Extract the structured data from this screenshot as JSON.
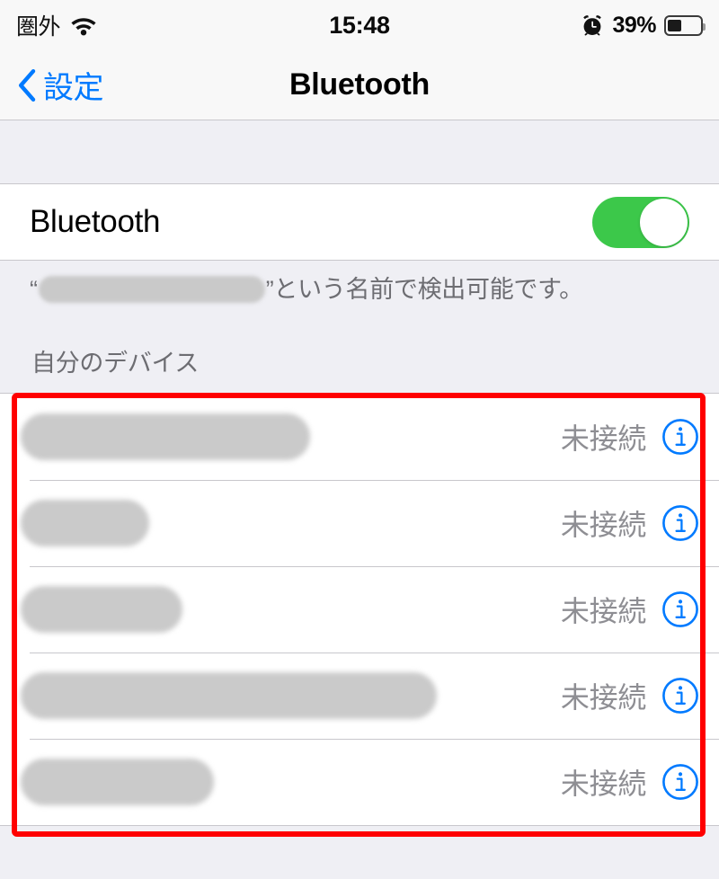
{
  "status_bar": {
    "carrier": "圏外",
    "wifi_icon": "wifi-icon",
    "time": "15:48",
    "alarm_icon": "alarm-clock-icon",
    "battery_percent": "39%",
    "battery_icon": "battery-icon"
  },
  "nav_bar": {
    "back_icon": "chevron-left-icon",
    "back_label": "設定",
    "title": "Bluetooth"
  },
  "bluetooth_row": {
    "label": "Bluetooth",
    "toggle_state": "on",
    "toggle_color": "#3CC84A"
  },
  "footer_note": {
    "open_quote": "“",
    "device_name_redacted": "",
    "close_quote": "”",
    "text": "という名前で検出可能です。"
  },
  "section": {
    "header": "自分のデバイス"
  },
  "devices": [
    {
      "name_redacted": "",
      "pill_width": 322,
      "status": "未接続",
      "info_icon": "info-circle-icon"
    },
    {
      "name_redacted": "",
      "pill_width": 143,
      "status": "未接続",
      "info_icon": "info-circle-icon"
    },
    {
      "name_redacted": "",
      "pill_width": 180,
      "status": "未接続",
      "info_icon": "info-circle-icon"
    },
    {
      "name_redacted": "",
      "pill_width": 463,
      "status": "未接続",
      "info_icon": "info-circle-icon"
    },
    {
      "name_redacted": "",
      "pill_width": 215,
      "status": "未接続",
      "info_icon": "info-circle-icon"
    }
  ],
  "annotation": {
    "highlight_color": "#FF0000",
    "shape": "rectangle-outline"
  },
  "colors": {
    "accent_blue": "#007AFF",
    "toggle_green": "#3CC84A",
    "background": "#EFEFF4",
    "cell_background": "#FFFFFF",
    "separator": "#C8C7CC",
    "secondary_text": "#8E8E93",
    "section_text": "#6D6D72"
  }
}
